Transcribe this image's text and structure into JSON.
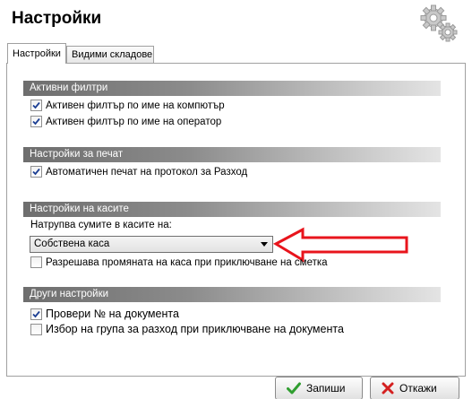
{
  "window": {
    "title": "Настройки"
  },
  "tabs": [
    {
      "label": "Настройки",
      "active": true
    },
    {
      "label": "Видими складове",
      "active": false
    }
  ],
  "sections": {
    "filters": {
      "title": "Активни филтри",
      "items": [
        {
          "label": "Активен филтър по име на компютър",
          "checked": true
        },
        {
          "label": "Активен филтър по име на оператор",
          "checked": true
        }
      ]
    },
    "print": {
      "title": "Настройки за печат",
      "items": [
        {
          "label": "Автоматичен печат на протокол за Разход",
          "checked": true
        }
      ]
    },
    "cash": {
      "title": "Настройки на касите",
      "accumulate_label": "Натрупва сумите в касите на:",
      "combo_value": "Собствена каса",
      "items": [
        {
          "label": "Разрешава промяната на каса при приключване на сметка",
          "checked": false
        }
      ]
    },
    "other": {
      "title": "Други настройки",
      "items": [
        {
          "label": "Провери № на документа",
          "checked": true
        },
        {
          "label": "Избор на група за разход при приключване на документа",
          "checked": false
        }
      ]
    }
  },
  "buttons": {
    "save": "Запиши",
    "cancel": "Откажи"
  },
  "icons": {
    "header": "gears-icon",
    "save": "checkmark-icon",
    "cancel": "red-x-icon"
  },
  "colors": {
    "section_header_start": "#6e6e6e",
    "annotation_arrow": "#e8141c",
    "check_mark": "#1c3f94",
    "save_icon": "#2f9e2f",
    "cancel_icon": "#d42020"
  }
}
